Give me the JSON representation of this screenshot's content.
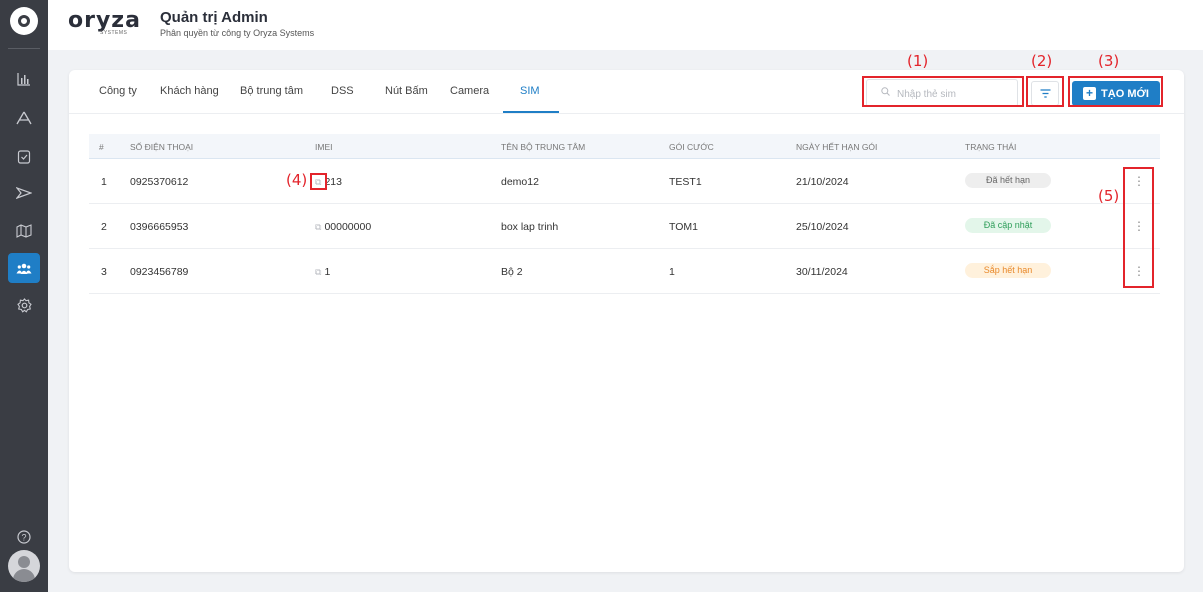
{
  "header": {
    "brand": "oryza",
    "brand_sub": "SYSTEMS",
    "title": "Quản trị Admin",
    "subtitle": "Phân quyền từ công ty Oryza Systems"
  },
  "sidebar": {
    "items": [
      {
        "icon": "bar-chart-icon",
        "glyph": "▥"
      },
      {
        "icon": "road-sign-icon",
        "glyph": "⩓"
      },
      {
        "icon": "clipboard-check-icon",
        "glyph": "▣"
      },
      {
        "icon": "drone-icon",
        "glyph": "⌲"
      },
      {
        "icon": "map-icon",
        "glyph": "▤"
      },
      {
        "icon": "users-icon",
        "glyph": "👥",
        "active": true
      },
      {
        "icon": "settings-icon",
        "glyph": "⚙"
      }
    ],
    "help_glyph": "?"
  },
  "tabs": [
    {
      "label": "Công ty"
    },
    {
      "label": "Khách hàng"
    },
    {
      "label": "Bộ trung tâm"
    },
    {
      "label": "DSS"
    },
    {
      "label": "Nút Bấm"
    },
    {
      "label": "Camera"
    },
    {
      "label": "SIM",
      "active": true
    }
  ],
  "search": {
    "placeholder": "Nhập thẻ sim",
    "value": ""
  },
  "create_button": {
    "label": "TẠO MỚI"
  },
  "table": {
    "headers": [
      "#",
      "SỐ ĐIỆN THOẠI",
      "IMEI",
      "TÊN BỘ TRUNG TÂM",
      "GÓI CƯỚC",
      "NGÀY HẾT HẠN GÓI",
      "TRẠNG THÁI"
    ],
    "rows": [
      {
        "index": "1",
        "phone": "0925370612",
        "imei": "213",
        "center": "demo12",
        "plan": "TEST1",
        "expiry": "21/10/2024",
        "status": "Đã hết hạn",
        "status_color": "#666666",
        "status_bg": "#eeeeee"
      },
      {
        "index": "2",
        "phone": "0396665953",
        "imei": "00000000",
        "center": "box lap trinh",
        "plan": "TOM1",
        "expiry": "25/10/2024",
        "status": "Đã cập nhật",
        "status_color": "#2f9e5a",
        "status_bg": "#e3f6ea"
      },
      {
        "index": "3",
        "phone": "0923456789",
        "imei": "1",
        "center": "Bộ 2",
        "plan": "1",
        "expiry": "30/11/2024",
        "status": "Sắp hết hạn",
        "status_color": "#e8892b",
        "status_bg": "#fff1dc"
      }
    ]
  },
  "annotations": [
    "(1)",
    "(2)",
    "(3)",
    "(4)",
    "(5)"
  ],
  "colors": {
    "accent": "#1f7ec6",
    "sidebar": "#3a3d44",
    "annotation": "#e3242b"
  }
}
